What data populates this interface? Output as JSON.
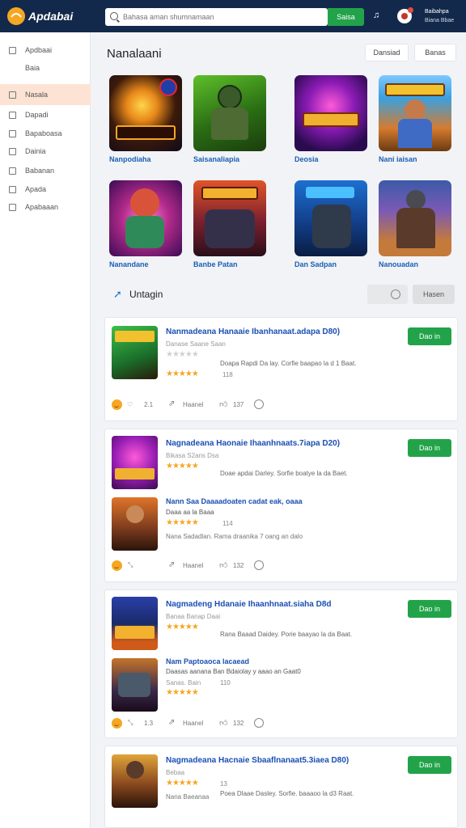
{
  "topbar": {
    "logo_text": "Apdabai",
    "search_placeholder": "Bahasa aman shumnamaan",
    "search_button": "Saisa",
    "user_name": "Baibahpa",
    "user_sub": "Biana Bbae"
  },
  "sidebar": {
    "items": [
      {
        "label": "Apdbaai",
        "active": false
      },
      {
        "label": "Baia",
        "active": false
      },
      {
        "label": "Nasala",
        "active": true
      },
      {
        "label": "Dapadi",
        "active": false
      },
      {
        "label": "Bapaboasa",
        "active": false
      },
      {
        "label": "Dainia",
        "active": false
      },
      {
        "label": "Babanan",
        "active": false
      },
      {
        "label": "Apada",
        "active": false
      },
      {
        "label": "Apabaaan",
        "active": false
      }
    ]
  },
  "header": {
    "title": "Nanalaani",
    "btn1": "Dansiad",
    "btn2": "Banas"
  },
  "games": [
    {
      "name": "Nanpodiaha"
    },
    {
      "name": "Saisanaliapia"
    },
    {
      "name": "Deosia"
    },
    {
      "name": "Nani iaisan"
    },
    {
      "name": "Nanandane"
    },
    {
      "name": "Banbe Patan"
    },
    {
      "name": "Dan Sadpan"
    },
    {
      "name": "Nanouadan"
    }
  ],
  "section": {
    "title": "Untagin",
    "button": "Hasen"
  },
  "cards": [
    {
      "title": "Nanmadeana Hanaaie Ibanhanaat.adapa D80)",
      "download": "Dao in",
      "sub": "Danase Saane Saan",
      "desc": "Doapa Rapdi Da lay. Corfie baapao la d 1 Baat.",
      "rating_count": "118",
      "f_n1": "2.1",
      "f_label": "Haanel",
      "f_n2": "137"
    },
    {
      "title": "Nagnadeana Haonaie Ihaanhnaats.7iapa D20)",
      "download": "Dao in",
      "sub": "Bikasa S2ans Dsa",
      "desc": "Doae apdai Darley. Sorfie boatye la da Baet.",
      "sub_title": "Nann Saa Daaaadoaten cadat eak, oaaa",
      "sub_line": "Daaa aa la Baaa",
      "sub_count": "114",
      "sub_desc": "Nana Sadadlan. Rama draanika 7 oang an dalo",
      "f_n1": "",
      "f_label": "Haanel",
      "f_n2": "132"
    },
    {
      "title": "Nagmadeng Hdanaie Ihaanhnaat.siaha D8d",
      "download": "Dao in",
      "sub": "Banaa Banap Daai",
      "desc": "Rana Baaad Daidey. Porie baayao la da Baat.",
      "sub_title": "Nam Paptoaoca lacaead",
      "sub_line": "Daasas aanana Ban Bdaiolay y aaao an Gaat0",
      "sub_count": "110",
      "sub_sub": "Sanas. Bain",
      "f_n1": "1.3",
      "f_label": "Haanel",
      "f_n2": "132"
    },
    {
      "title": "Nagmadeana Hacnaie Sbaaflnanaat5.3iaea D80)",
      "download": "Dao in",
      "sub": "Bebaa",
      "sub_count": "13",
      "desc": "Poea Dlaae Dasley. Sorfie. baaaoo la d3 Raat.",
      "sub_line": "Nana Baeanaa"
    }
  ]
}
